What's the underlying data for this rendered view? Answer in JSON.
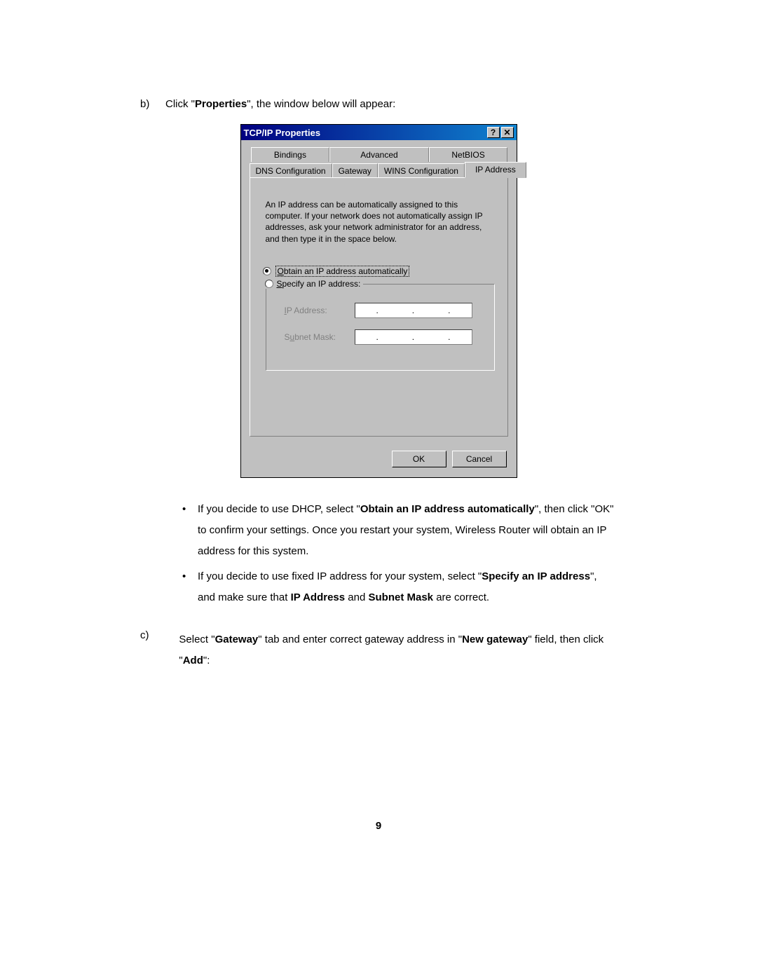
{
  "step_b": {
    "label": "b)",
    "prefix": "Click \"",
    "bold": "Properties",
    "suffix": "\", the window below will appear:"
  },
  "dialog": {
    "title": "TCP/IP Properties",
    "help_icon": "?",
    "close_icon": "✕",
    "tabs_back": [
      "Bindings",
      "Advanced",
      "NetBIOS"
    ],
    "tabs_front": [
      "DNS Configuration",
      "Gateway",
      "WINS Configuration",
      "IP Address"
    ],
    "intro": "An IP address can be automatically assigned to this computer. If your network does not automatically assign IP addresses, ask your network administrator for an address, and then type it in the space below.",
    "radio1": "Obtain an IP address automatically",
    "radio2": "Specify an IP address:",
    "field1": "IP Address:",
    "field2": "Subnet Mask:",
    "ok": "OK",
    "cancel": "Cancel"
  },
  "bullets": {
    "b1_pre": "If you decide to use DHCP, select \"",
    "b1_bold": "Obtain an IP address automatically",
    "b1_post": "\", then click \"OK\" to confirm your settings.    Once you restart your system, Wireless Router will obtain an IP address for this system.",
    "b2_pre": "If you decide to use fixed IP address for your system, select \"",
    "b2_bold1": "Specify an IP address",
    "b2_mid1": "\", and make sure that ",
    "b2_bold2": "IP Address",
    "b2_mid2": " and ",
    "b2_bold3": "Subnet Mask",
    "b2_post": " are correct."
  },
  "step_c": {
    "label": "c)",
    "pre": "Select \"",
    "bold1": "Gateway",
    "mid1": "\" tab and enter correct gateway address in \"",
    "bold2": "New gateway",
    "mid2": "\" field, then click \"",
    "bold3": "Add",
    "post": "\":"
  },
  "page_number": "9"
}
